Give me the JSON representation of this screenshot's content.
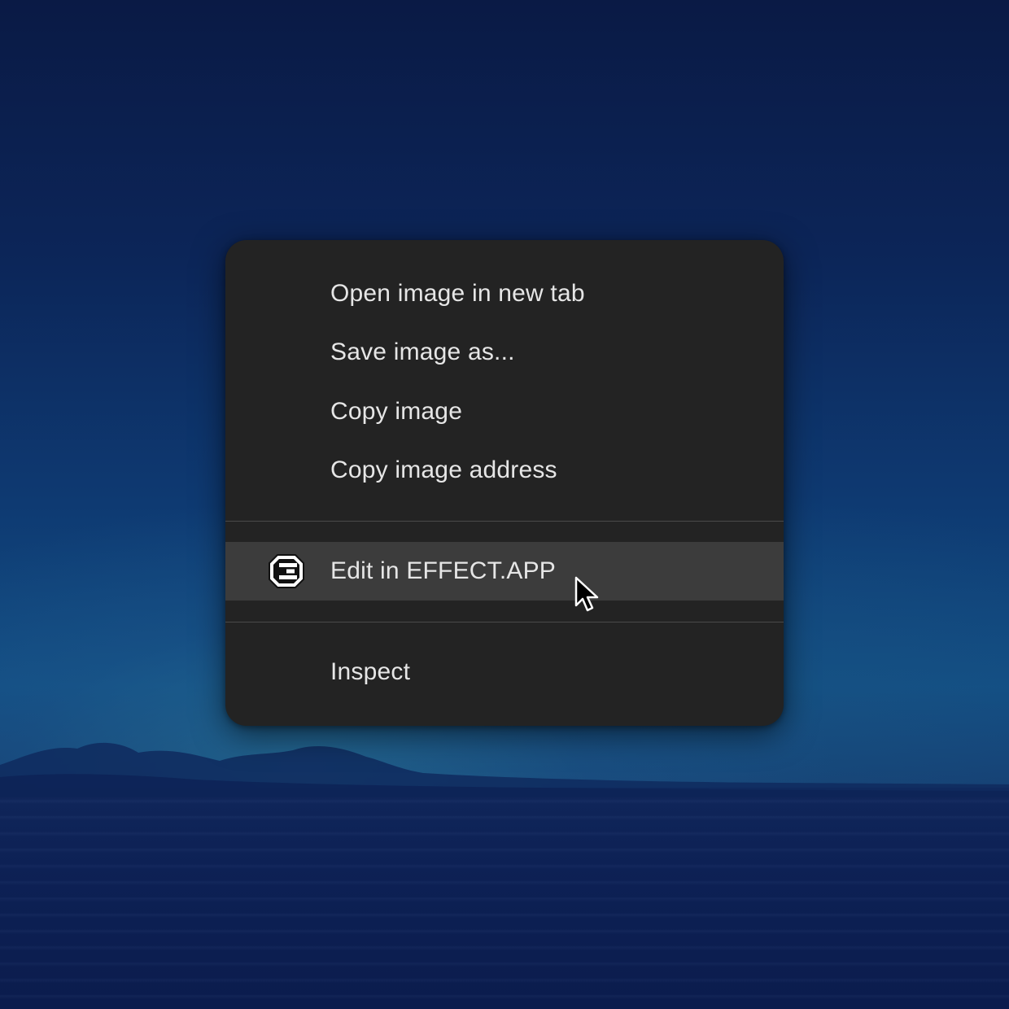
{
  "context_menu": {
    "items": [
      {
        "label": "Open image in new tab"
      },
      {
        "label": "Save image as..."
      },
      {
        "label": "Copy image"
      },
      {
        "label": "Copy image address"
      }
    ],
    "extension_item": {
      "label": "Edit in EFFECT.APP",
      "icon": "effect-app-logo-icon",
      "highlighted": true
    },
    "footer_item": {
      "label": "Inspect"
    }
  },
  "colors": {
    "menu_background": "#232323",
    "highlight_background": "#3c3c3c",
    "menu_text": "#e6e6e6",
    "separator": "#4a4a4a"
  },
  "pointer": {
    "icon": "mouse-pointer-icon"
  }
}
